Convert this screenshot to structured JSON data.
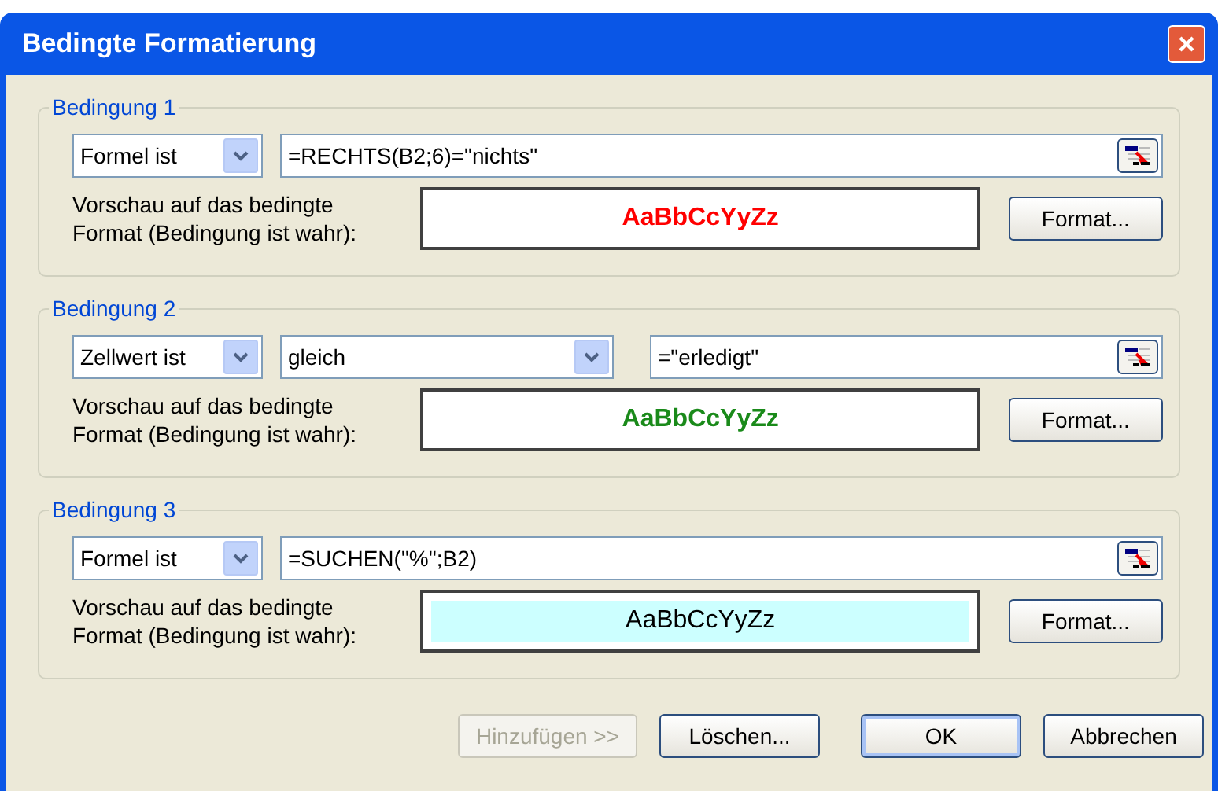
{
  "window": {
    "title": "Bedingte Formatierung"
  },
  "conditions": [
    {
      "title": "Bedingung 1",
      "kind": "formula",
      "operand": "Formel ist",
      "value": "=RECHTS(B2;6)=\"nichts\"",
      "preview_label": "Vorschau auf das bedingte Format (Bedingung ist wahr):",
      "preview": {
        "text": "AaBbCcYyZz",
        "color": "#ff0000",
        "bold": true,
        "highlighted": false
      },
      "format_button": "Format..."
    },
    {
      "title": "Bedingung 2",
      "kind": "cellvalue",
      "operand": "Zellwert ist",
      "operator": "gleich",
      "value": "=\"erledigt\"",
      "preview_label": "Vorschau auf das bedingte Format (Bedingung ist wahr):",
      "preview": {
        "text": "AaBbCcYyZz",
        "color": "#1a8a1a",
        "bold": true,
        "highlighted": false
      },
      "format_button": "Format..."
    },
    {
      "title": "Bedingung 3",
      "kind": "formula",
      "operand": "Formel ist",
      "value": "=SUCHEN(\"%\";B2)",
      "preview_label": "Vorschau auf das bedingte Format (Bedingung ist wahr):",
      "preview": {
        "text": "AaBbCcYyZz",
        "color": "#000000",
        "bold": false,
        "highlighted": true
      },
      "format_button": "Format..."
    }
  ],
  "buttons": [
    {
      "label": "Hinzufügen >>",
      "disabled": true
    },
    {
      "label": "Löschen...",
      "disabled": false
    },
    {
      "label": "OK",
      "disabled": false,
      "default": true
    },
    {
      "label": "Abbrechen",
      "disabled": false
    }
  ]
}
